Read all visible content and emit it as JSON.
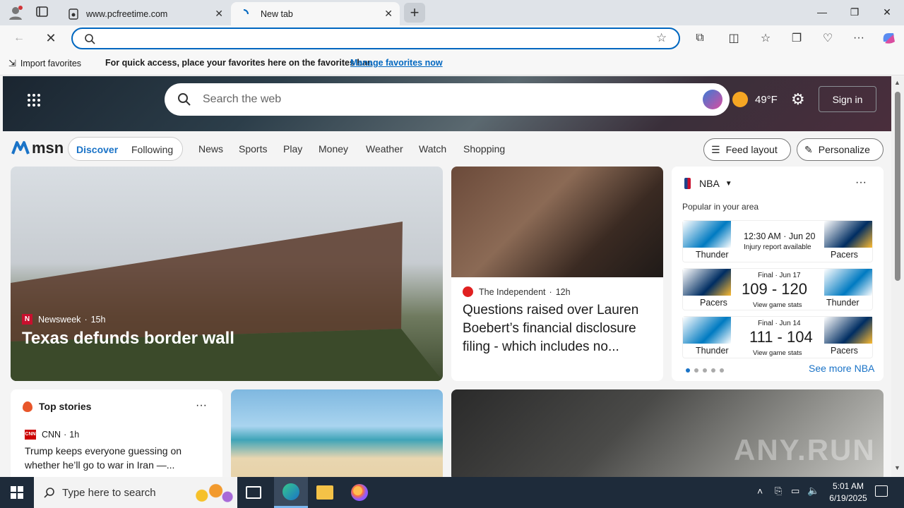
{
  "browser": {
    "tabs": [
      {
        "title": "www.pcfreetime.com"
      },
      {
        "title": "New tab"
      }
    ],
    "favorites_bar": {
      "import_label": "Import favorites",
      "message": "For quick access, place your favorites here on the favorites bar.",
      "manage_link": "Manage favorites now"
    }
  },
  "hero": {
    "search_placeholder": "Search the web",
    "temperature": "49°F",
    "signin_label": "Sign in"
  },
  "msn_nav": {
    "logo": "msn",
    "tabs": [
      "Discover",
      "Following"
    ],
    "links": [
      "News",
      "Sports",
      "Play",
      "Money",
      "Weather",
      "Watch",
      "Shopping"
    ],
    "feed_layout": "Feed layout",
    "personalize": "Personalize"
  },
  "main_story": {
    "source": "Newsweek",
    "age": "15h",
    "headline": "Texas defunds border wall"
  },
  "second_story": {
    "source": "The Independent",
    "age": "12h",
    "headline": "Questions raised over Lauren Boebert’s financial disclosure filing - which includes no..."
  },
  "nba": {
    "title": "NBA",
    "subtitle": "Popular in your area",
    "see_more": "See more NBA",
    "games": [
      {
        "left_team": "Thunder",
        "right_team": "Pacers",
        "line1": "12:30 AM · Jun 20",
        "line2": "Injury report available",
        "score": ""
      },
      {
        "left_team": "Pacers",
        "right_team": "Thunder",
        "line1": "Final · Jun 17",
        "score": "109 - 120",
        "line2": "View game stats"
      },
      {
        "left_team": "Thunder",
        "right_team": "Pacers",
        "line1": "Final · Jun 14",
        "score": "111 - 104",
        "line2": "View game stats"
      }
    ]
  },
  "top_stories": {
    "title": "Top stories",
    "source": "CNN",
    "age": "1h",
    "headline": "Trump keeps everyone guessing on whether he’ll go to war in Iran —..."
  },
  "taskbar": {
    "search_placeholder": "Type here to search",
    "time": "5:01 AM",
    "date": "6/19/2025"
  },
  "watermark": "ANY.RUN",
  "colors": {
    "accent": "#0067c0",
    "msn_blue": "#1a73c7",
    "taskbar": "#1e2b3a"
  }
}
